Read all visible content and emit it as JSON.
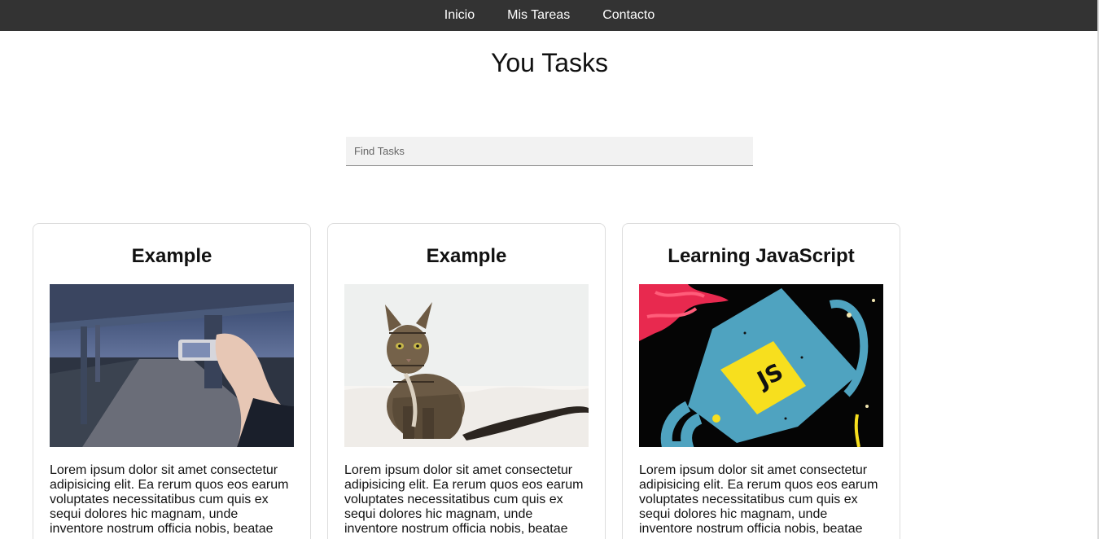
{
  "nav": {
    "items": [
      {
        "label": "Inicio"
      },
      {
        "label": "Mis Tareas"
      },
      {
        "label": "Contacto"
      }
    ]
  },
  "page": {
    "title": "You Tasks"
  },
  "search": {
    "placeholder": "Find Tasks",
    "value": ""
  },
  "cards": [
    {
      "title": "Example",
      "image": "road-bridge-photo-icon",
      "text": "Lorem ipsum dolor sit amet consectetur adipisicing elit. Ea rerum quos eos earum voluptates necessitatibus cum quis ex sequi dolores hic magnam, unde inventore nostrum officia nobis, beatae"
    },
    {
      "title": "Example",
      "image": "cat-photo-icon",
      "text": "Lorem ipsum dolor sit amet consectetur adipisicing elit. Ea rerum quos eos earum voluptates necessitatibus cum quis ex sequi dolores hic magnam, unde inventore nostrum officia nobis, beatae"
    },
    {
      "title": "Learning JavaScript",
      "image": "js-mug-illustration-icon",
      "text": "Lorem ipsum dolor sit amet consectetur adipisicing elit. Ea rerum quos eos earum voluptates necessitatibus cum quis ex sequi dolores hic magnam, unde inventore nostrum officia nobis, beatae"
    }
  ],
  "colors": {
    "navbar": "#333333",
    "nav_text": "#ffffff",
    "search_bg": "#f2f2f2",
    "card_border": "#dddddd",
    "js_yellow": "#f7df1e",
    "js_mug_blue": "#4fa3c0"
  }
}
